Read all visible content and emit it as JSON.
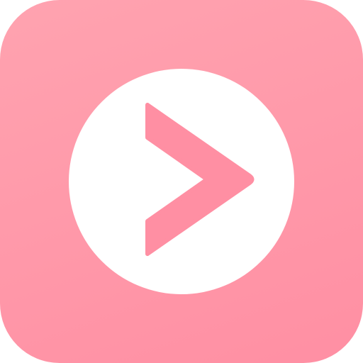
{
  "app_icon": {
    "icon": "play-chevron-icon",
    "colors": {
      "background_start": "#FFA3B0",
      "background_end": "#FF8FA3",
      "disc": "#FFFFFF",
      "glyph": "#FF8FA3"
    }
  }
}
